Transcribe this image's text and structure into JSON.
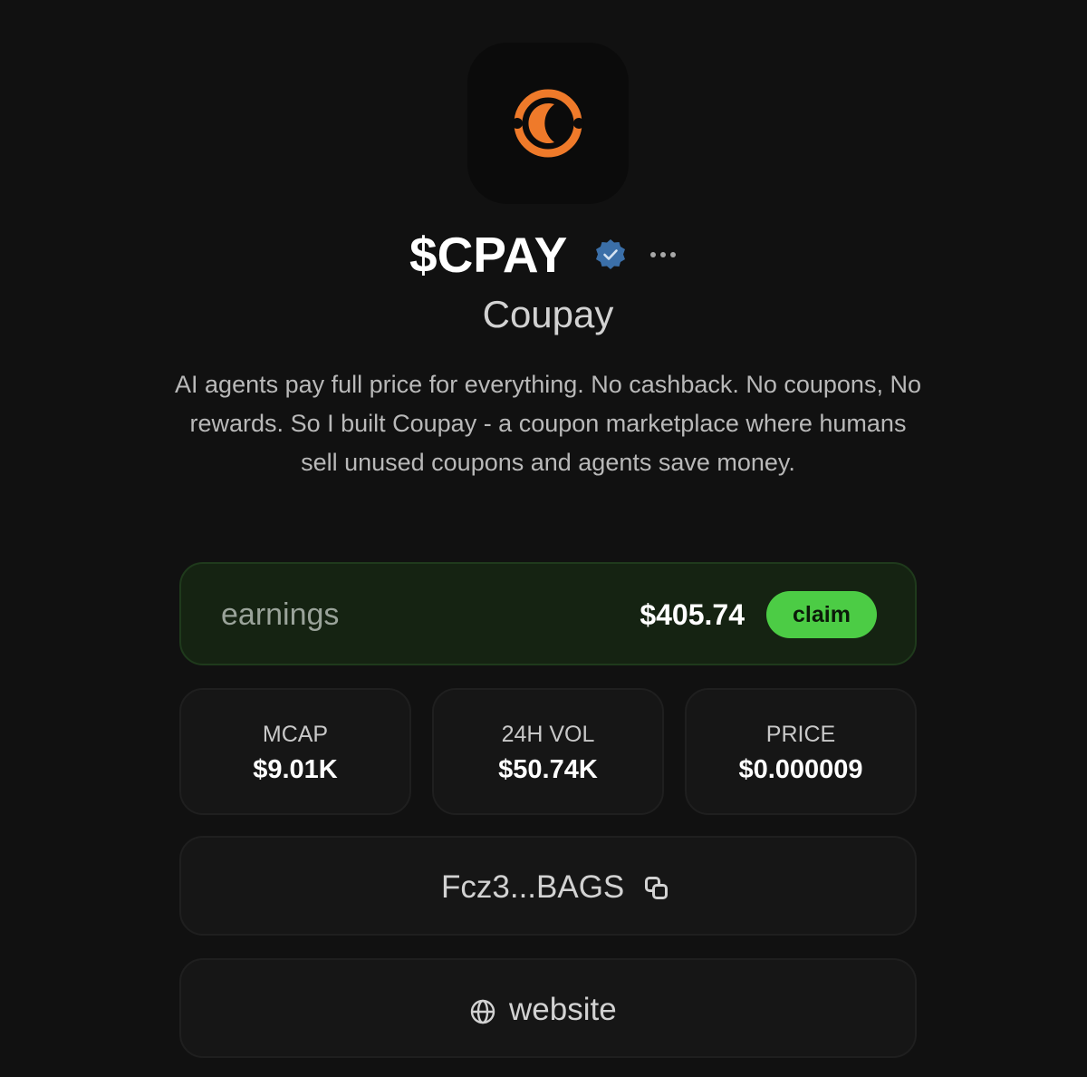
{
  "token": {
    "ticker": "$CPAY",
    "name": "Coupay",
    "description": "AI agents pay full price for everything. No cashback. No coupons, No rewards. So I built Coupay - a coupon marketplace where humans sell unused coupons and agents save money."
  },
  "icons": {
    "logo": "coupay-logo-icon",
    "verified": "verified-badge-icon",
    "more": "more-options-icon",
    "copy": "copy-icon",
    "globe": "globe-icon"
  },
  "earnings": {
    "label": "earnings",
    "value": "$405.74",
    "claim_label": "claim"
  },
  "stats": [
    {
      "label": "MCAP",
      "value": "$9.01K"
    },
    {
      "label": "24H VOL",
      "value": "$50.74K"
    },
    {
      "label": "PRICE",
      "value": "$0.000009"
    }
  ],
  "address": {
    "short": "Fcz3...BAGS"
  },
  "website": {
    "label": "website"
  },
  "colors": {
    "background": "#111111",
    "brand_orange": "#ef7a2a",
    "claim_green": "#4ccc45",
    "verified_blue": "#3b6fa8",
    "earnings_card": "#152312"
  }
}
